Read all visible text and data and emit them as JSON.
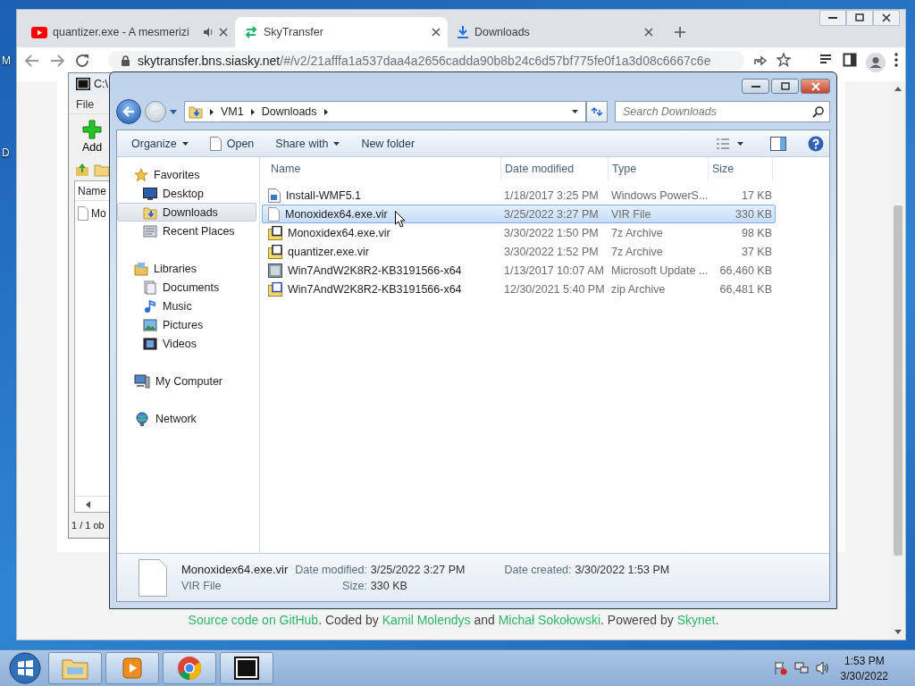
{
  "desktop": {
    "icon_labels": [
      "M",
      "D"
    ]
  },
  "browser": {
    "tabs": [
      {
        "title": "quantizer.exe - A mesmerizi",
        "kind": "video",
        "playing_audio": true,
        "selected": false
      },
      {
        "title": "SkyTransfer",
        "kind": "site",
        "playing_audio": false,
        "selected": true
      },
      {
        "title": "Downloads",
        "kind": "download",
        "playing_audio": false,
        "selected": false
      }
    ],
    "url_host": "skytransfer.bns.siasky.net",
    "url_path": "/#/v2/21afffa1a537daa4a2656cadda90b8b24c6d57bf775fe0f1a3d08c6667c6e",
    "footer": [
      {
        "text": "Source code on GitHub",
        "kind": "link"
      },
      {
        "text": ". Coded by ",
        "kind": "plain"
      },
      {
        "text": "Kamil Molendys",
        "kind": "link"
      },
      {
        "text": " and ",
        "kind": "plain"
      },
      {
        "text": "Michał Sokołowski",
        "kind": "link"
      },
      {
        "text": ". Powered by ",
        "kind": "plain"
      },
      {
        "text": "Skynet",
        "kind": "link"
      },
      {
        "text": ".",
        "kind": "plain"
      }
    ]
  },
  "archiver": {
    "title": "C:\\",
    "menu": [
      "File"
    ],
    "tool": "Add",
    "column": "Name",
    "item": "Mo",
    "status": "1 / 1 ob"
  },
  "explorer": {
    "breadcrumb": [
      "VM1",
      "Downloads"
    ],
    "search": {
      "placeholder": "Search Downloads"
    },
    "toolbar": [
      {
        "label": "Organize",
        "kind": "menu"
      },
      {
        "label": "Open",
        "kind": "open"
      },
      {
        "label": "Share with",
        "kind": "menu"
      },
      {
        "label": "New folder",
        "kind": "plain"
      }
    ],
    "nav": [
      {
        "label": "Favorites",
        "kind": "favorites",
        "selected": false,
        "children": [
          {
            "label": "Desktop",
            "kind": "desktop",
            "selected": false
          },
          {
            "label": "Downloads",
            "kind": "downloads",
            "selected": true
          },
          {
            "label": "Recent Places",
            "kind": "recent",
            "selected": false
          }
        ]
      },
      {
        "label": "Libraries",
        "kind": "libraries",
        "selected": false,
        "children": [
          {
            "label": "Documents",
            "kind": "documents",
            "selected": false
          },
          {
            "label": "Music",
            "kind": "music",
            "selected": false
          },
          {
            "label": "Pictures",
            "kind": "pictures",
            "selected": false
          },
          {
            "label": "Videos",
            "kind": "videos",
            "selected": false
          }
        ]
      },
      {
        "label": "My Computer",
        "kind": "computer",
        "selected": false
      },
      {
        "label": "Network",
        "kind": "network",
        "selected": false
      }
    ],
    "columns": [
      "Name",
      "Date modified",
      "Type",
      "Size"
    ],
    "files": [
      {
        "name": "Install-WMF5.1",
        "date": "1/18/2017 3:25 PM",
        "type": "Windows PowerS...",
        "size": "17 KB",
        "kind": "script",
        "selected": false
      },
      {
        "name": "Monoxidex64.exe.vir",
        "date": "3/25/2022 3:27 PM",
        "type": "VIR File",
        "size": "330 KB",
        "kind": "blank",
        "selected": true
      },
      {
        "name": "Monoxidex64.exe.vir",
        "date": "3/30/2022 1:50 PM",
        "type": "7z Archive",
        "size": "98 KB",
        "kind": "archive",
        "selected": false
      },
      {
        "name": "quantizer.exe.vir",
        "date": "3/30/2022 1:52 PM",
        "type": "7z Archive",
        "size": "37 KB",
        "kind": "archive",
        "selected": false
      },
      {
        "name": "Win7AndW2K8R2-KB3191566-x64",
        "date": "1/13/2017 10:07 AM",
        "type": "Microsoft Update ...",
        "size": "66,460 KB",
        "kind": "update",
        "selected": false
      },
      {
        "name": "Win7AndW2K8R2-KB3191566-x64",
        "date": "12/30/2021 5:40 PM",
        "type": "zip Archive",
        "size": "66,481 KB",
        "kind": "zip",
        "selected": false
      }
    ],
    "details": {
      "name": "Monoxidex64.exe.vir",
      "type": "VIR File",
      "fields": [
        {
          "label": "Date modified:",
          "value": "3/25/2022 3:27 PM"
        },
        {
          "label": "Size:",
          "value": "330 KB"
        },
        {
          "label": "Date created:",
          "value": "3/30/2022 1:53 PM"
        }
      ]
    }
  },
  "taskbar": {
    "items": [
      {
        "kind": "explorer"
      },
      {
        "kind": "media"
      },
      {
        "kind": "browser"
      },
      {
        "kind": "archiver"
      }
    ],
    "tray": [
      {
        "kind": "flag"
      },
      {
        "kind": "network"
      },
      {
        "kind": "speaker"
      }
    ],
    "time": "1:53 PM",
    "date": "3/30/2022"
  }
}
